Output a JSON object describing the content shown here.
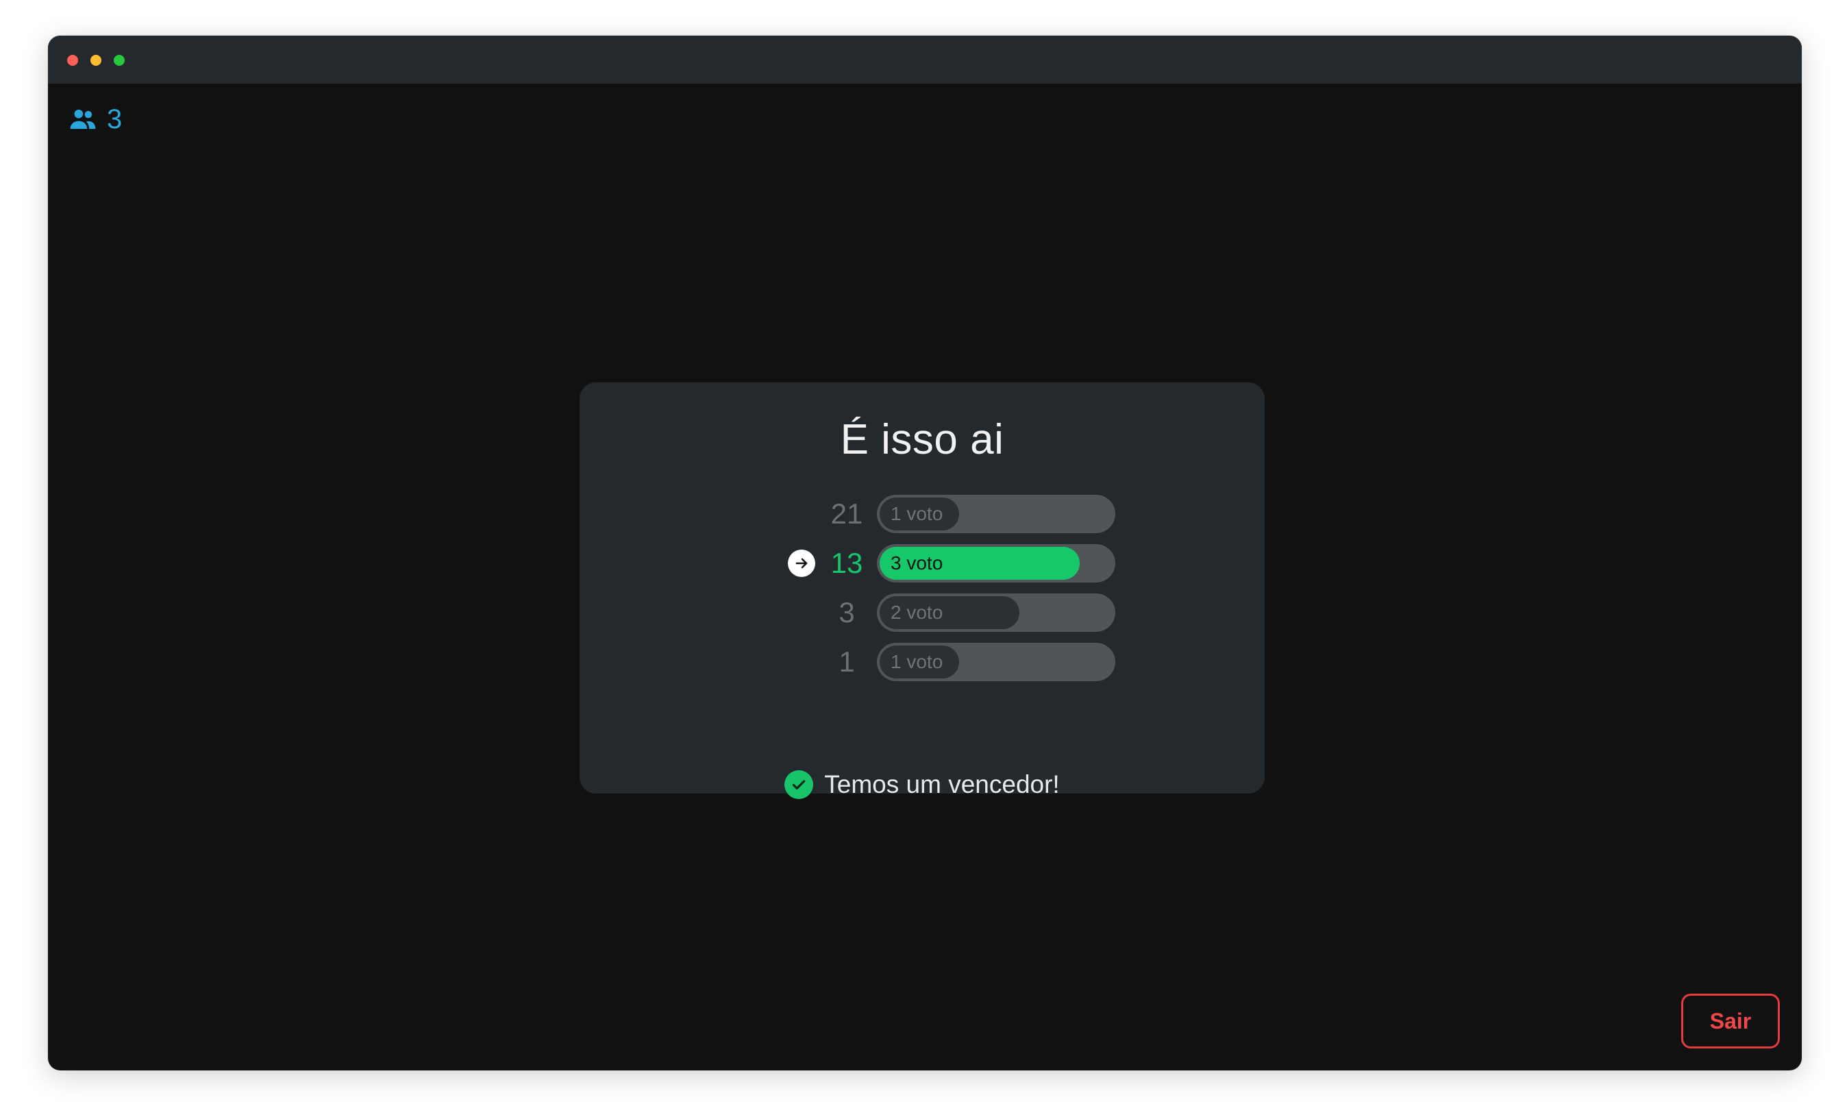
{
  "header": {
    "participants_icon": "users-icon",
    "participants_count": "3"
  },
  "result": {
    "title": "É isso ai",
    "votes": [
      {
        "value": "21",
        "label": "1 voto",
        "votes": 1,
        "winner": false
      },
      {
        "value": "13",
        "label": "3 voto",
        "votes": 3,
        "winner": true
      },
      {
        "value": "3",
        "label": "2 voto",
        "votes": 2,
        "winner": false
      },
      {
        "value": "1",
        "label": "1 voto",
        "votes": 1,
        "winner": false
      }
    ],
    "max_votes": 3,
    "winner_icon": "arrow-right-icon",
    "status_icon": "check-circle-icon",
    "status_text": "Temos um vencedor!"
  },
  "footer": {
    "exit_label": "Sair"
  },
  "colors": {
    "accent_green": "#17c46a",
    "participants_blue": "#2aa6dc",
    "danger_red": "#e43c3c"
  }
}
